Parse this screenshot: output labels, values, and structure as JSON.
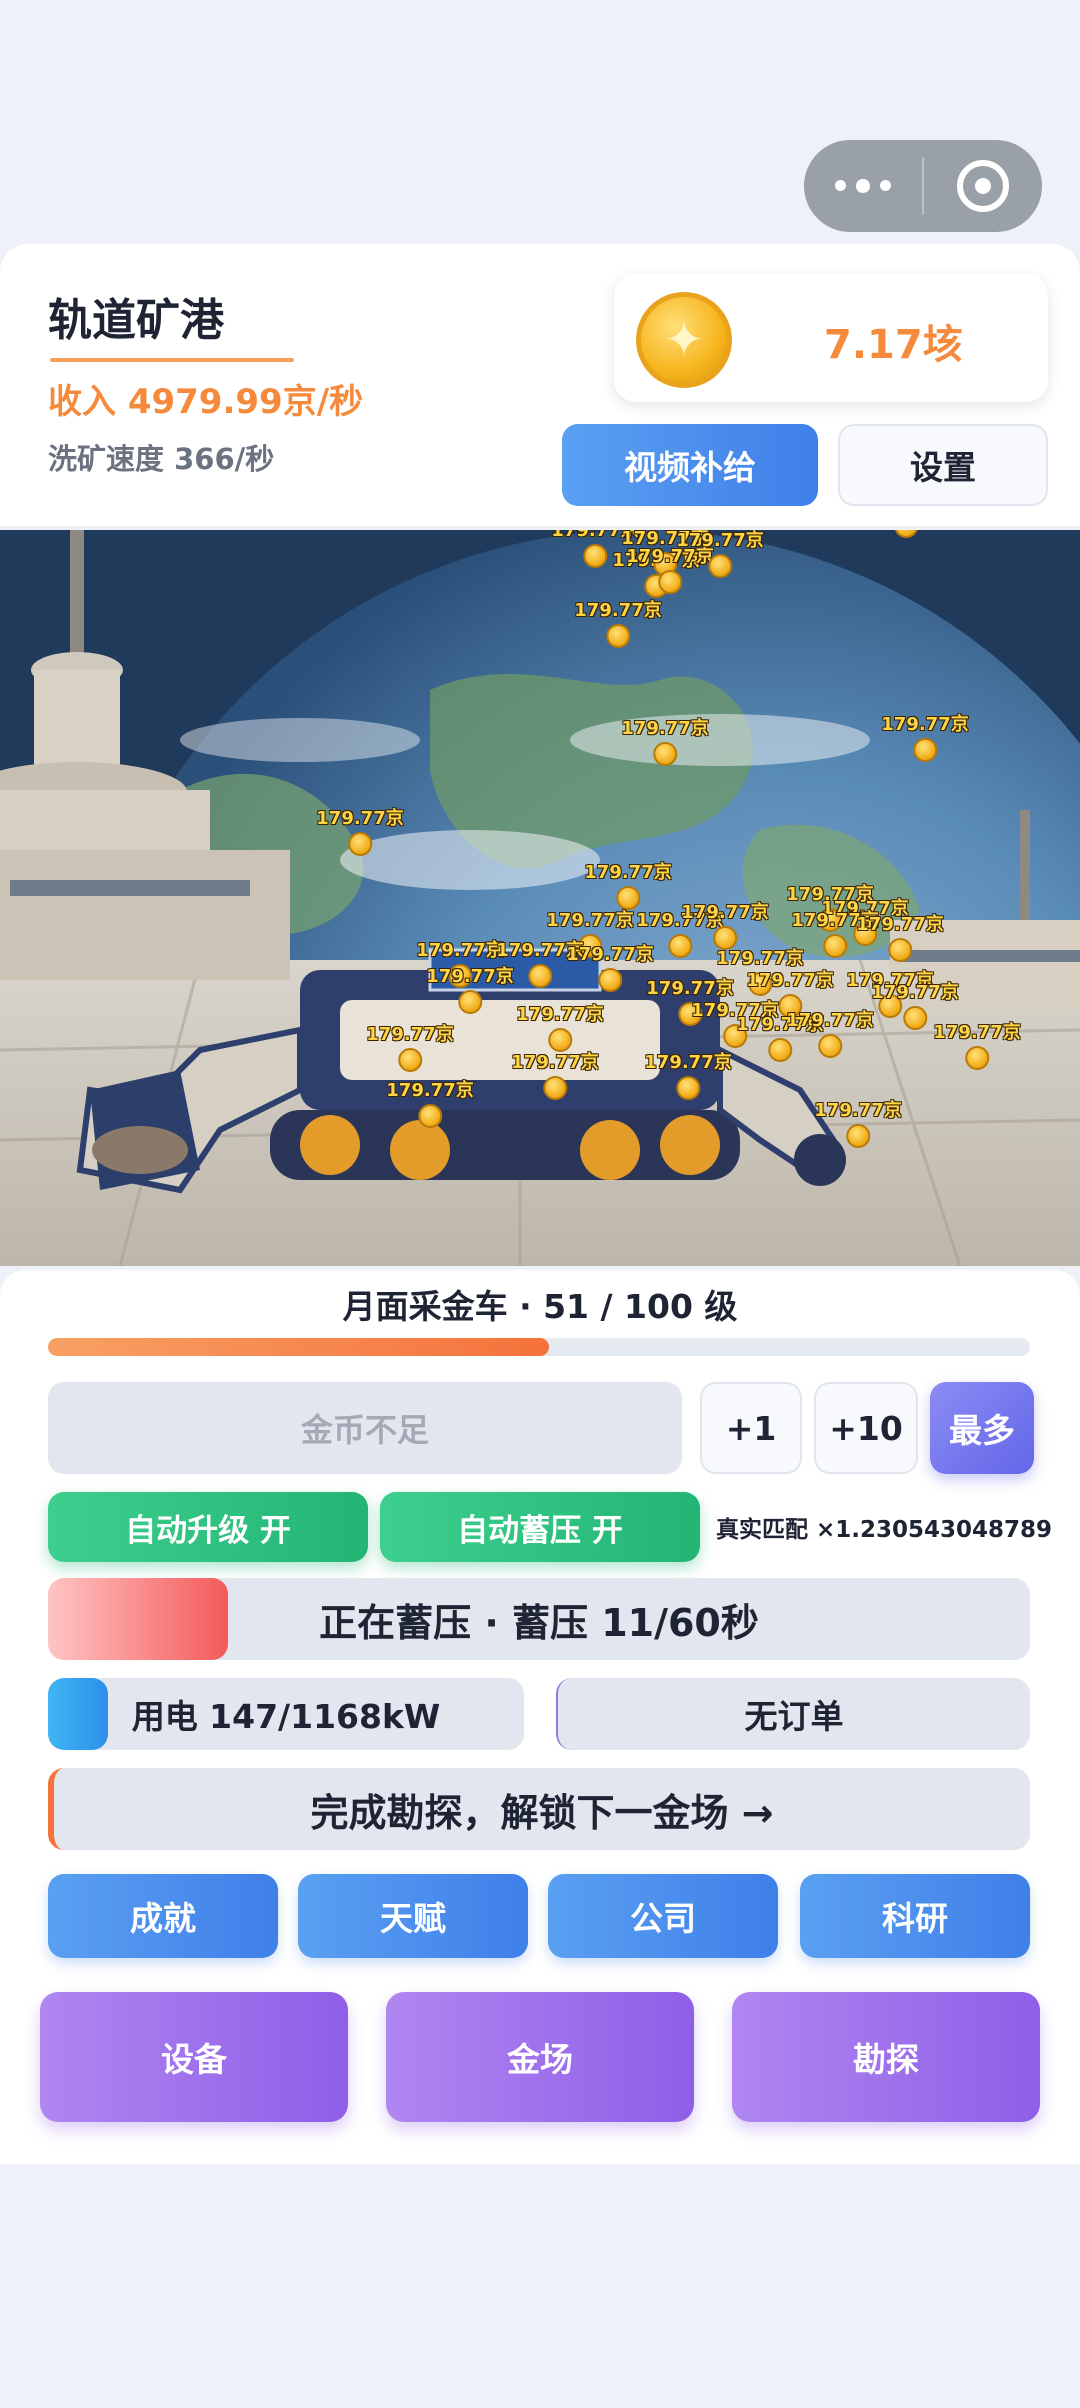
{
  "header": {
    "title": "轨道矿港",
    "income": "收入 4979.99京/秒",
    "wash_speed": "洗矿速度 366/秒",
    "coin_amount": "7.17垓",
    "video_button": "视频补给",
    "settings_button": "设置"
  },
  "floating_reward": "179.77京",
  "vehicle": {
    "level_text": "月面采金车 · 51 / 100 级",
    "level_progress": 0.51
  },
  "upgrade": {
    "main_button": "金币不足",
    "plus1": "+1",
    "plus10": "+10",
    "max": "最多"
  },
  "toggles": {
    "auto_upgrade": "自动升级 开",
    "auto_charge": "自动蓄压 开",
    "multiplier": "真实匹配 ×1.230543048789"
  },
  "charge": {
    "text": "正在蓄压 · 蓄压 11/60秒",
    "progress": 0.1833
  },
  "power": {
    "text": "用电 147/1168kW",
    "progress": 0.126
  },
  "orders": {
    "text": "无订单"
  },
  "explore": {
    "text": "完成勘探，解锁下一金场 →"
  },
  "nav_row1": [
    "成就",
    "天赋",
    "公司",
    "科研"
  ],
  "nav_row2": [
    "设备",
    "金场",
    "勘探"
  ],
  "colors": {
    "accent_orange": "#f58a3c",
    "blue": "#3f7fe9",
    "green": "#22b573",
    "purple": "#8f5ee8"
  }
}
